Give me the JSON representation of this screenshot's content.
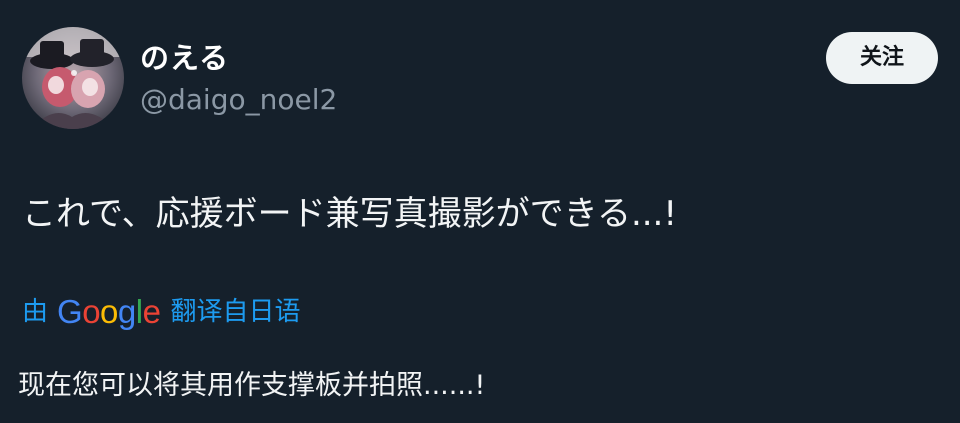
{
  "user": {
    "display_name": "のえる",
    "handle": "@daigo_noel2"
  },
  "follow_button": {
    "label": "关注"
  },
  "tweet": {
    "text": "これで、応援ボード兼写真撮影ができる...!"
  },
  "translation": {
    "prefix": "由",
    "provider_letters": [
      "G",
      "o",
      "o",
      "g",
      "l",
      "e"
    ],
    "suffix": "翻译自日语",
    "translated_text": "现在您可以将其用作支撑板并拍照......!"
  },
  "colors": {
    "background": "#15202b",
    "link": "#1d9bf0",
    "secondary_text": "#8b98a5",
    "button_bg": "#eff3f4"
  }
}
